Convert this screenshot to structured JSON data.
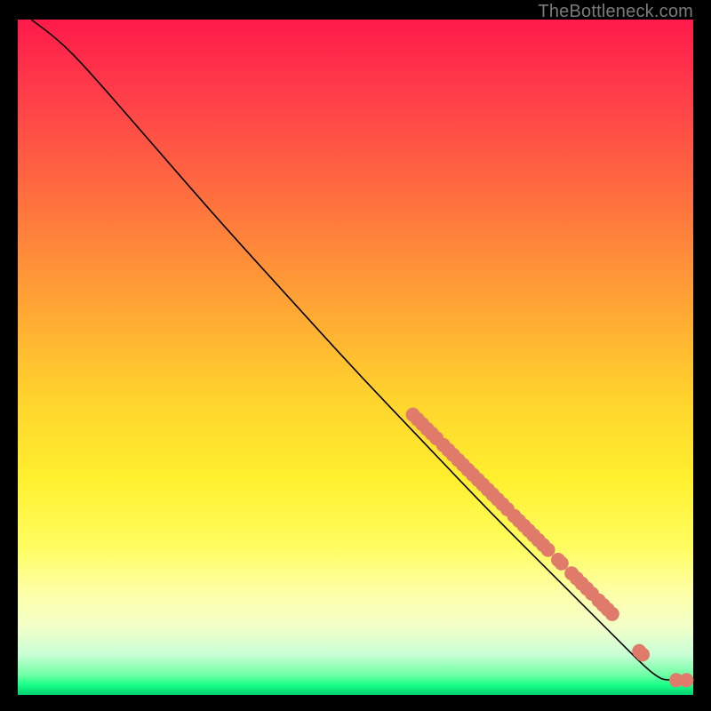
{
  "watermark": "TheBottleneck.com",
  "colors": {
    "dot": "#e07a6a",
    "curve": "#000000",
    "gradient_stops": [
      {
        "at": 0.0,
        "hex": "#ff1a4a"
      },
      {
        "at": 0.1,
        "hex": "#ff3a4a"
      },
      {
        "at": 0.25,
        "hex": "#ff6b3f"
      },
      {
        "at": 0.4,
        "hex": "#ff9d36"
      },
      {
        "at": 0.55,
        "hex": "#ffd02d"
      },
      {
        "at": 0.68,
        "hex": "#fff02e"
      },
      {
        "at": 0.78,
        "hex": "#fffd60"
      },
      {
        "at": 0.85,
        "hex": "#fdffa8"
      },
      {
        "at": 0.9,
        "hex": "#f2ffc9"
      },
      {
        "at": 0.94,
        "hex": "#c9ffd6"
      },
      {
        "at": 0.97,
        "hex": "#6fffa4"
      },
      {
        "at": 0.985,
        "hex": "#19ff87"
      },
      {
        "at": 1.0,
        "hex": "#00d070"
      }
    ]
  },
  "chart_data": {
    "type": "line",
    "title": "",
    "xlabel": "",
    "ylabel": "",
    "xlim": [
      0,
      100
    ],
    "ylim": [
      0,
      100
    ],
    "note": "No axis tick labels rendered; coordinates are percentages of the plotting area (0,0 at top-left).",
    "curve_points_pct": [
      [
        2.0,
        0.0
      ],
      [
        6.0,
        3.0
      ],
      [
        10.0,
        7.0
      ],
      [
        20.0,
        18.5
      ],
      [
        30.0,
        30.0
      ],
      [
        40.0,
        41.0
      ],
      [
        50.0,
        52.0
      ],
      [
        60.0,
        62.5
      ],
      [
        70.0,
        73.0
      ],
      [
        80.0,
        83.0
      ],
      [
        88.0,
        91.0
      ],
      [
        93.0,
        96.0
      ],
      [
        95.0,
        97.5
      ],
      [
        96.0,
        97.8
      ],
      [
        100.0,
        97.8
      ]
    ],
    "dot_segments_pct": [
      {
        "from": [
          58.5,
          58.5
        ],
        "to": [
          62.0,
          62.0
        ]
      },
      {
        "from": [
          63.0,
          63.0
        ],
        "to": [
          72.5,
          72.5
        ]
      },
      {
        "from": [
          73.5,
          73.5
        ],
        "to": [
          78.5,
          78.5
        ]
      },
      {
        "from": [
          80.0,
          80.0
        ],
        "to": [
          80.5,
          80.5
        ]
      },
      {
        "from": [
          82.0,
          82.0
        ],
        "to": [
          85.0,
          85.0
        ]
      },
      {
        "from": [
          86.0,
          86.0
        ],
        "to": [
          88.0,
          88.0
        ]
      },
      {
        "from": [
          92.0,
          93.5
        ],
        "to": [
          92.5,
          94.0
        ]
      }
    ],
    "end_dots_pct": [
      {
        "at": [
          97.5,
          97.8
        ]
      },
      {
        "at": [
          99.0,
          97.8
        ]
      }
    ],
    "dot_radius_pct": 1.05,
    "dot_spacing_pct": 1.0
  }
}
